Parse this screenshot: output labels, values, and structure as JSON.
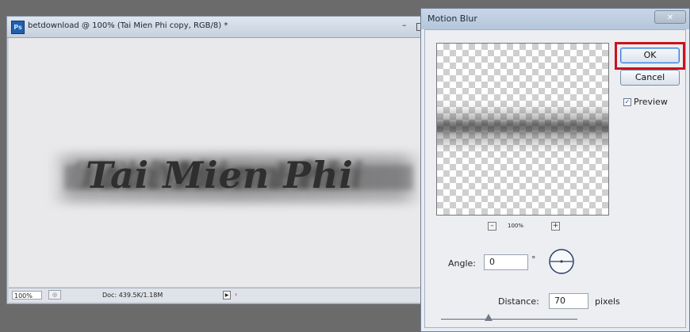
{
  "document_window": {
    "title": "betdownload @ 100% (Tai Mien Phi copy, RGB/8) *",
    "app_icon": "Ps",
    "minimize": "–",
    "canvas_text": "Tai Mien Phi",
    "status": {
      "zoom": "100%",
      "doc_size": "Doc: 439.5K/1.18M",
      "arrow": "▶",
      "less": "‹"
    }
  },
  "motion_blur_dialog": {
    "title": "Motion Blur",
    "close_label": "✕",
    "ok_label": "OK",
    "cancel_label": "Cancel",
    "preview_label": "Preview",
    "preview_checked": true,
    "check_mark": "✓",
    "preview_zoom": "100%",
    "zoom_minus": "–",
    "zoom_plus": "+",
    "angle_label": "Angle:",
    "angle_value": "0",
    "degree_symbol": "°",
    "distance_label": "Distance:",
    "distance_value": "70",
    "distance_unit": "pixels",
    "highlight_color": "#c8141e"
  }
}
